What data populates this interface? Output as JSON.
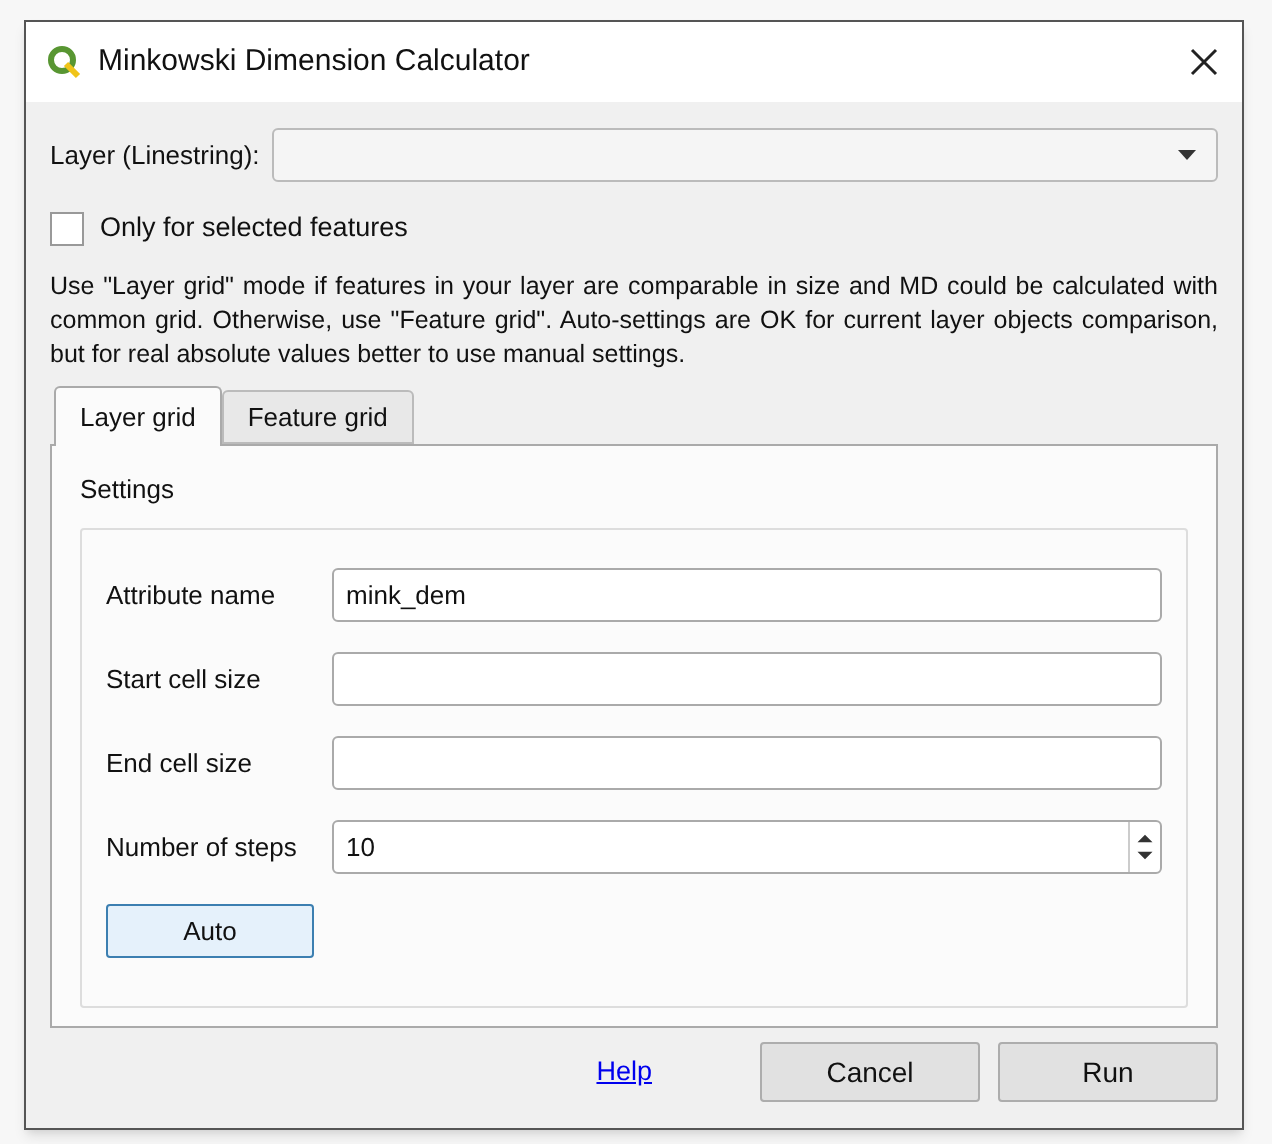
{
  "window": {
    "title": "Minkowski Dimension Calculator"
  },
  "layer": {
    "label": "Layer (Linestring):"
  },
  "selected_only": {
    "label": "Only for selected features",
    "checked": false
  },
  "description": "Use \"Layer grid\" mode if features in your layer are comparable in size and MD could be calculated with common grid. Otherwise, use \"Feature grid\". Auto-settings are OK for current layer objects comparison, but for real absolute values better to use manual settings.",
  "tabs": [
    {
      "label": "Layer grid",
      "selected": true
    },
    {
      "label": "Feature grid",
      "selected": false
    }
  ],
  "settings": {
    "title": "Settings",
    "fields": [
      {
        "label": "Attribute name",
        "value": "mink_dem",
        "kind": "text"
      },
      {
        "label": "Start cell size",
        "kind": "text"
      },
      {
        "label": "End cell size",
        "kind": "text"
      },
      {
        "label": "Number of steps",
        "value": "10",
        "kind": "spin"
      }
    ],
    "auto_button": "Auto"
  },
  "footer": {
    "help": "Help",
    "buttons": [
      "Cancel",
      "Run"
    ]
  }
}
